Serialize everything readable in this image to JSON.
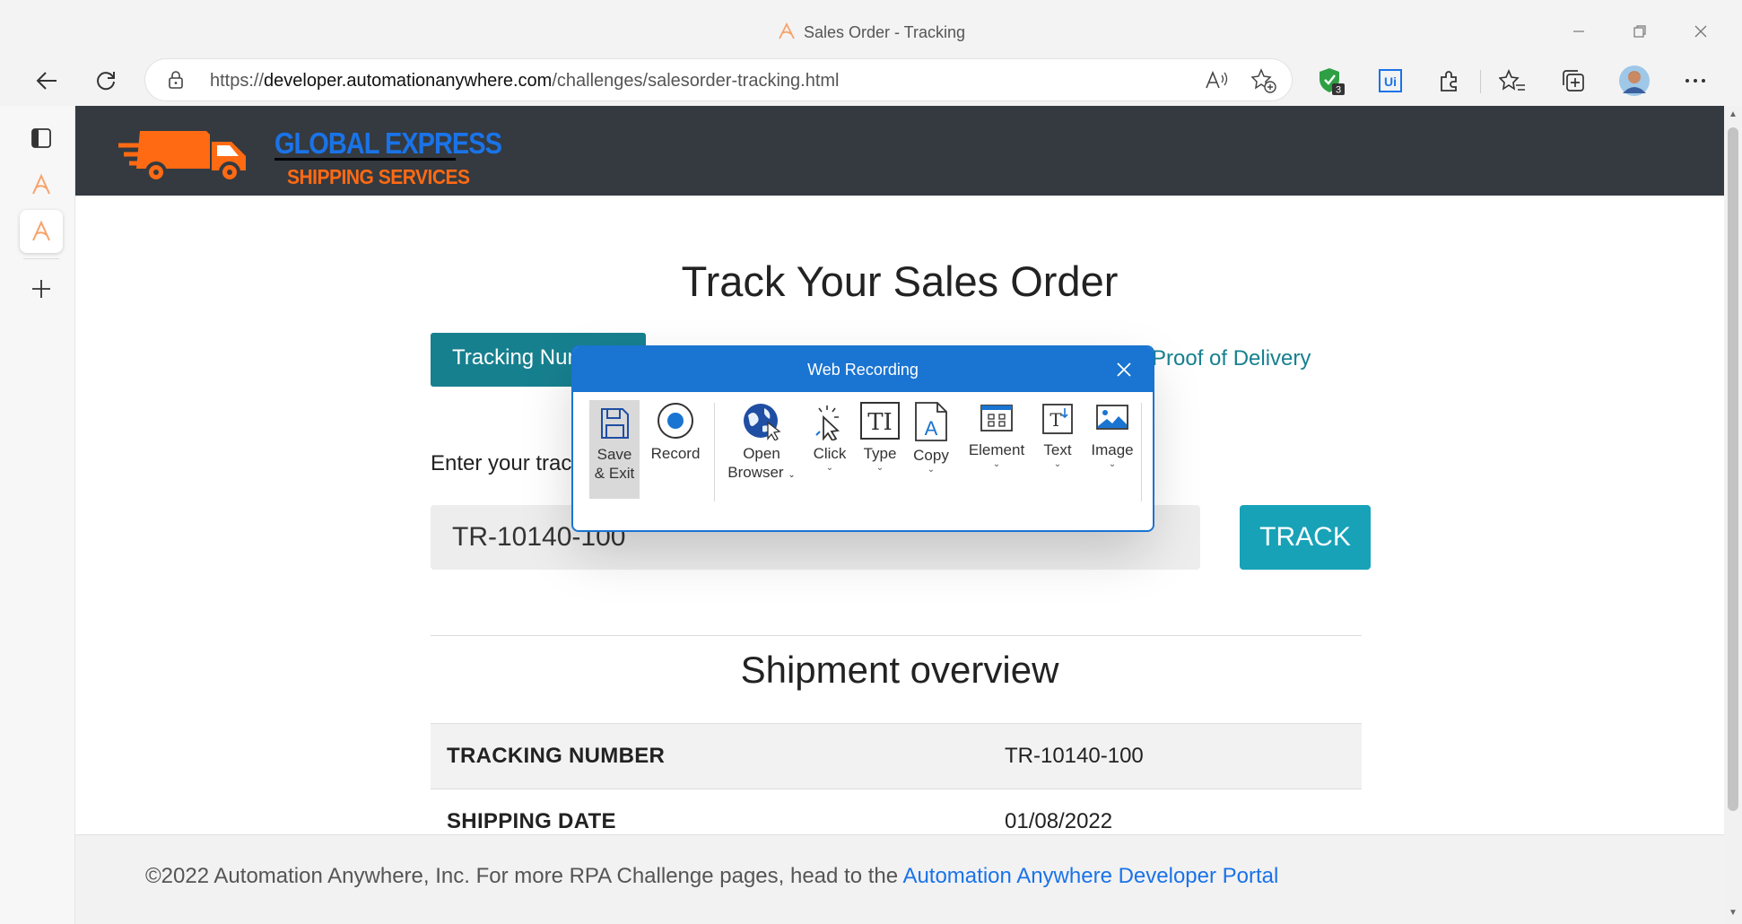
{
  "browser": {
    "window_title": "Sales Order - Tracking",
    "url_prefix": "https://",
    "url_host": "developer.automationanywhere.com",
    "url_path": "/challenges/salesorder-tracking.html",
    "extension_badge": "3",
    "extension_ui_label": "Ui"
  },
  "site": {
    "logo_line1": "GLOBAL EXPRESS",
    "logo_line2": "SHIPPING SERVICES",
    "page_title": "Track Your Sales Order",
    "tab_active_label": "Tracking Number",
    "tab_link_label": "Proof of Delivery",
    "enter_label": "Enter your tracking number:",
    "tracking_input_value": "TR-10140-100",
    "track_button": "TRACK",
    "overview_title": "Shipment overview",
    "overview_rows": [
      {
        "key": "TRACKING NUMBER",
        "value": "TR-10140-100"
      },
      {
        "key": "SHIPPING DATE",
        "value": "01/08/2022"
      }
    ],
    "footer_text": "©2022 Automation Anywhere, Inc. For more RPA Challenge pages, head to the ",
    "footer_link": "Automation Anywhere Developer Portal"
  },
  "recorder": {
    "title": "Web Recording",
    "tools": [
      {
        "line1": "Save",
        "line2": "& Exit"
      },
      {
        "line1": "Record",
        "line2": ""
      },
      {
        "line1": "Open",
        "line2": "Browser"
      },
      {
        "line1": "Click",
        "line2": ""
      },
      {
        "line1": "Type",
        "line2": ""
      },
      {
        "line1": "Copy",
        "line2": ""
      },
      {
        "line1": "Element",
        "line2": ""
      },
      {
        "line1": "Text",
        "line2": ""
      },
      {
        "line1": "Image",
        "line2": ""
      }
    ]
  },
  "colors": {
    "brand_teal": "#17808f",
    "track_button": "#17a2b8",
    "recorder_blue": "#1a74d1",
    "header_dark": "#343a40",
    "logo_orange": "#ff6a13",
    "logo_blue": "#1a73e8"
  }
}
